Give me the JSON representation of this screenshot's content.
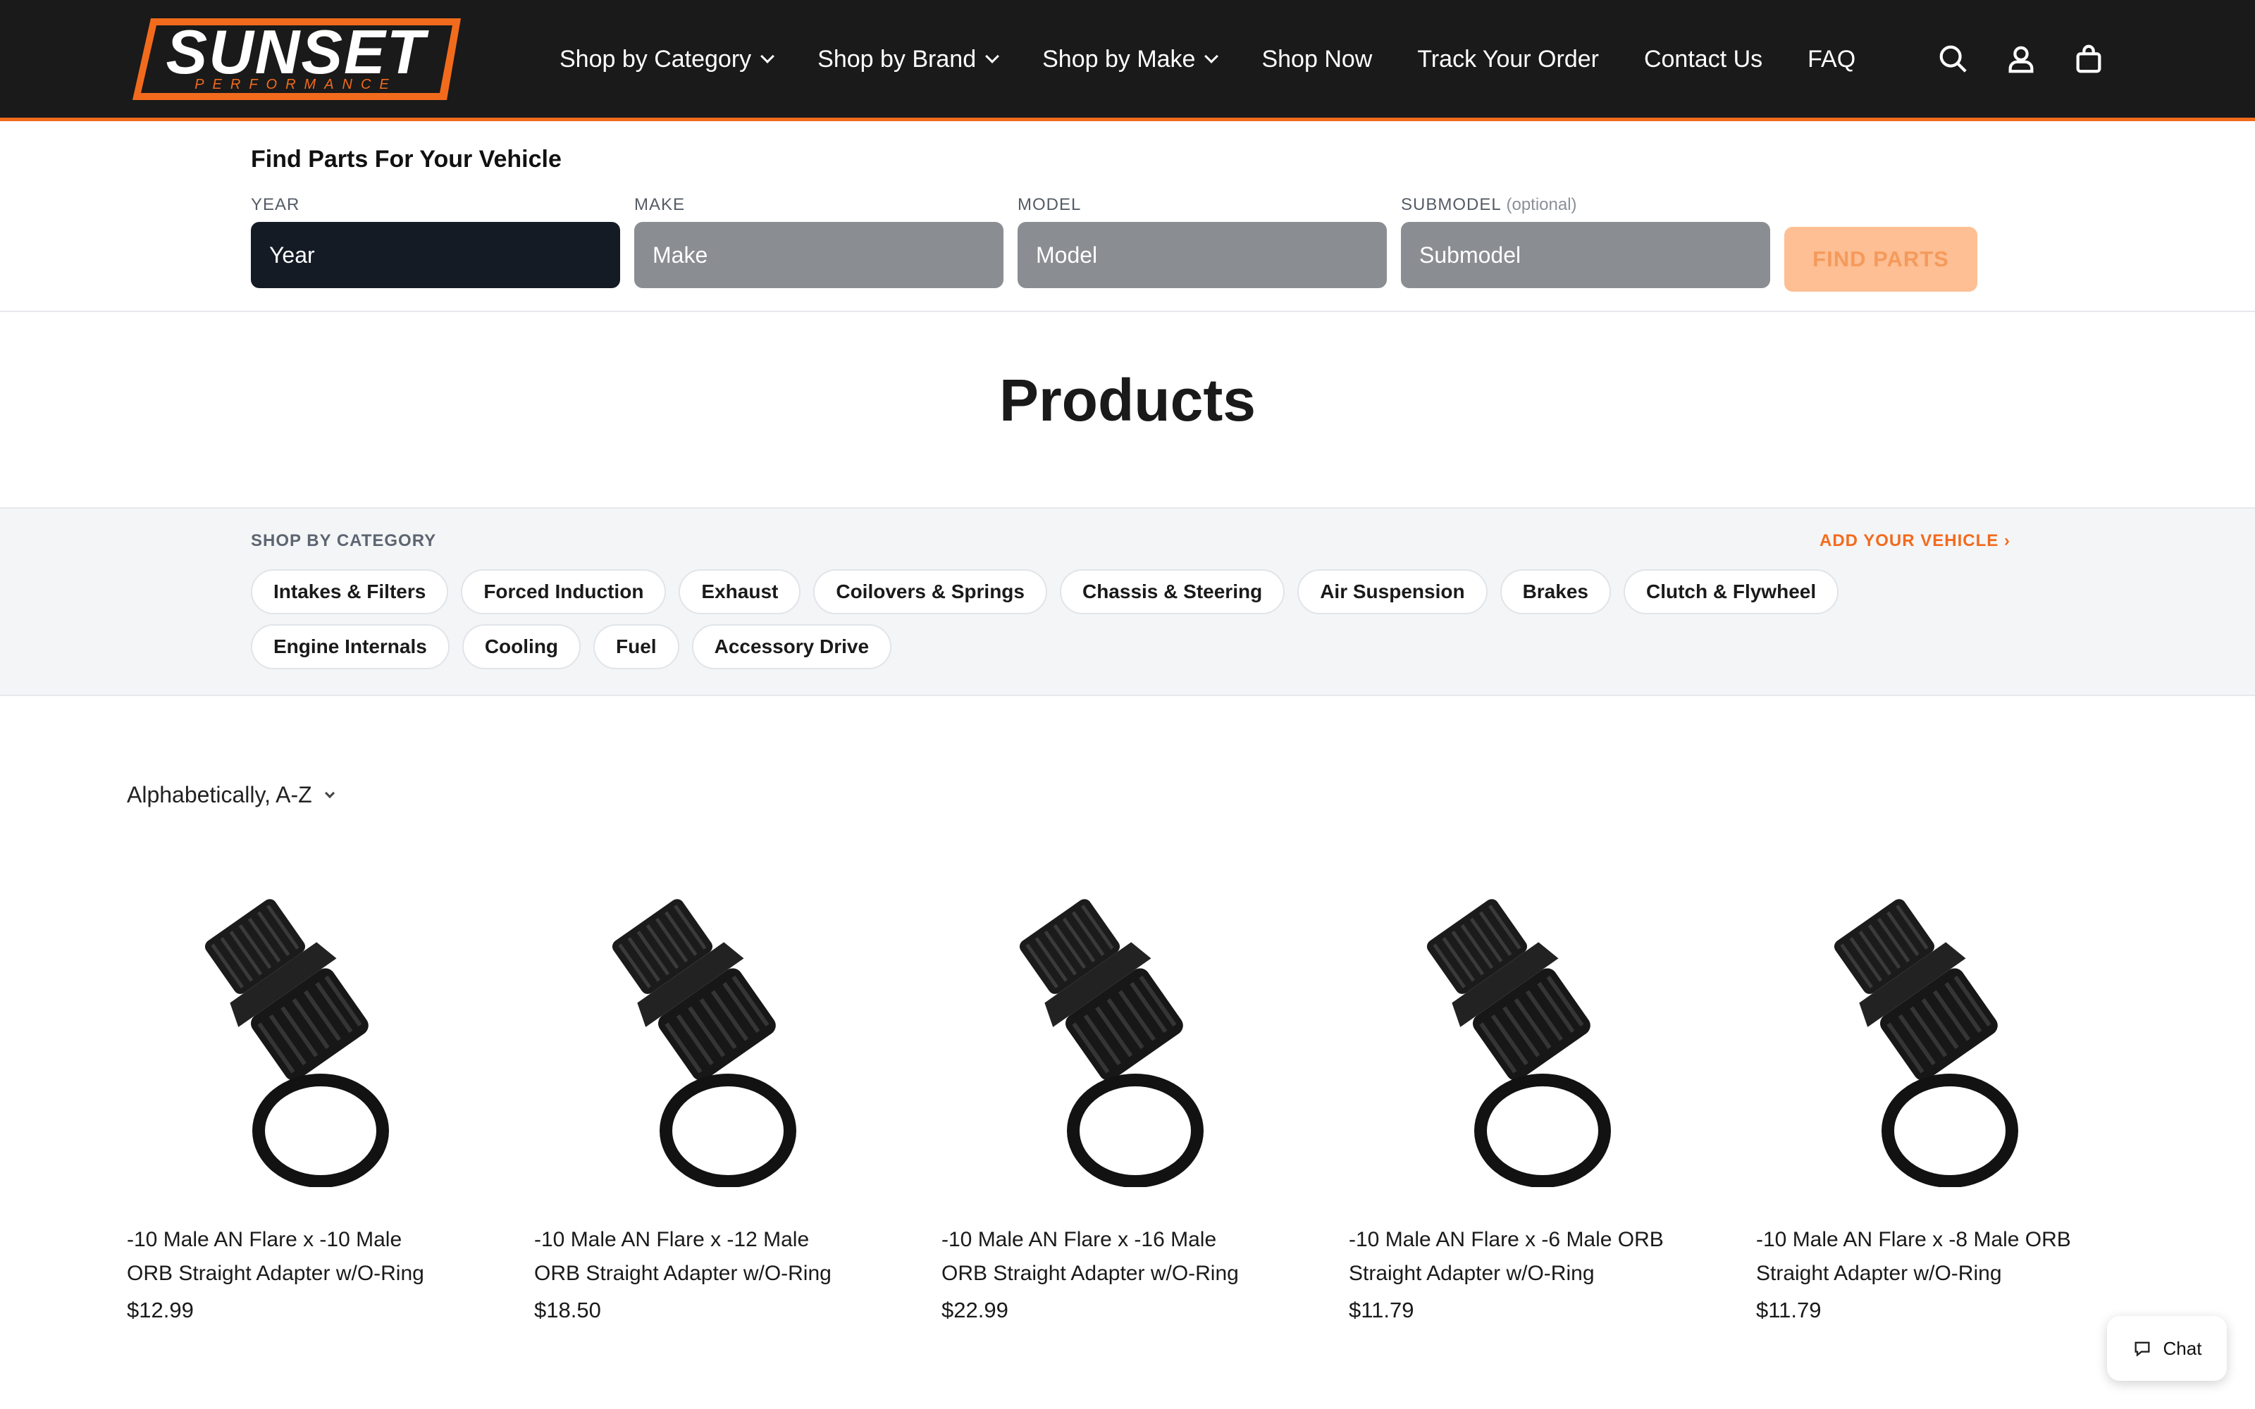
{
  "brand": {
    "name": "SUNSET",
    "tagline": "PERFORMANCE",
    "accent": "#f26b1d"
  },
  "nav": [
    {
      "label": "Shop by Category",
      "dropdown": true
    },
    {
      "label": "Shop by Brand",
      "dropdown": true
    },
    {
      "label": "Shop by Make",
      "dropdown": true
    },
    {
      "label": "Shop Now",
      "dropdown": false
    },
    {
      "label": "Track Your Order",
      "dropdown": false
    },
    {
      "label": "Contact Us",
      "dropdown": false
    },
    {
      "label": "FAQ",
      "dropdown": false
    }
  ],
  "header_icons": [
    "search-icon",
    "account-icon",
    "cart-icon"
  ],
  "finder": {
    "title": "Find Parts For Your Vehicle",
    "fields": [
      {
        "label": "YEAR",
        "optional": "",
        "value": "Year"
      },
      {
        "label": "MAKE",
        "optional": "",
        "value": "Make"
      },
      {
        "label": "MODEL",
        "optional": "",
        "value": "Model"
      },
      {
        "label": "SUBMODEL",
        "optional": "(optional)",
        "value": "Submodel"
      }
    ],
    "button": "FIND PARTS"
  },
  "page_title": "Products",
  "categories": {
    "heading": "SHOP BY CATEGORY",
    "add_vehicle": "ADD YOUR VEHICLE ›",
    "row1": [
      "Intakes & Filters",
      "Forced Induction",
      "Exhaust",
      "Coilovers & Springs",
      "Chassis & Steering",
      "Air Suspension",
      "Brakes",
      "Clutch & Flywheel"
    ],
    "row2": [
      "Engine Internals",
      "Cooling",
      "Fuel",
      "Accessory Drive"
    ]
  },
  "sort": {
    "label": "Alphabetically, A-Z"
  },
  "products": [
    {
      "title": "-10 Male AN Flare x -10 Male ORB Straight Adapter w/O-Ring",
      "price": "$12.99"
    },
    {
      "title": "-10 Male AN Flare x -12 Male ORB Straight Adapter w/O-Ring",
      "price": "$18.50"
    },
    {
      "title": "-10 Male AN Flare x -16 Male ORB Straight Adapter w/O-Ring",
      "price": "$22.99"
    },
    {
      "title": "-10 Male AN Flare x -6 Male ORB Straight Adapter w/O-Ring",
      "price": "$11.79"
    },
    {
      "title": "-10 Male AN Flare x -8 Male ORB Straight Adapter w/O-Ring",
      "price": "$11.79"
    }
  ],
  "chat": {
    "label": "Chat"
  }
}
